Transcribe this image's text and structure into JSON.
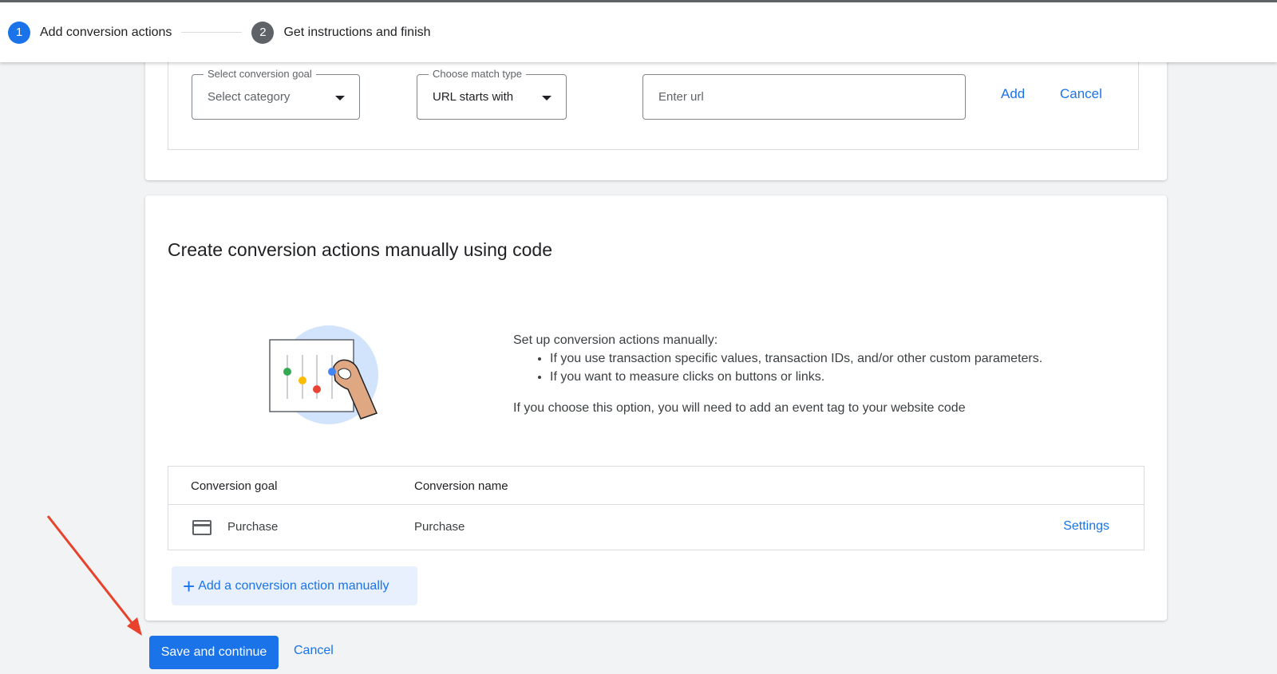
{
  "stepper": {
    "steps": [
      {
        "number": "1",
        "label": "Add conversion actions",
        "active": true
      },
      {
        "number": "2",
        "label": "Get instructions and finish",
        "active": false
      }
    ]
  },
  "url_rule": {
    "goal_label": "Select conversion goal",
    "goal_value": "Select category",
    "match_label": "Choose match type",
    "match_value": "URL starts with",
    "url_placeholder": "Enter url",
    "add_label": "Add",
    "cancel_label": "Cancel"
  },
  "manual": {
    "title": "Create conversion actions manually using code",
    "intro": "Set up conversion actions manually:",
    "bullets": [
      "If you use transaction specific values, transaction IDs, and/or other custom parameters.",
      "If you want to measure clicks on buttons or links."
    ],
    "note": "If you choose this option, you will need to add an event tag to your website code",
    "table": {
      "headers": [
        "Conversion goal",
        "Conversion name"
      ],
      "rows": [
        {
          "icon": "credit-card-icon",
          "goal": "Purchase",
          "name": "Purchase",
          "action": "Settings"
        }
      ]
    },
    "add_manual_label": "Add a conversion action manually"
  },
  "footer": {
    "save_label": "Save and continue",
    "cancel_label": "Cancel"
  },
  "colors": {
    "primary": "#1a73e8",
    "annotation_arrow": "#e8412c"
  }
}
